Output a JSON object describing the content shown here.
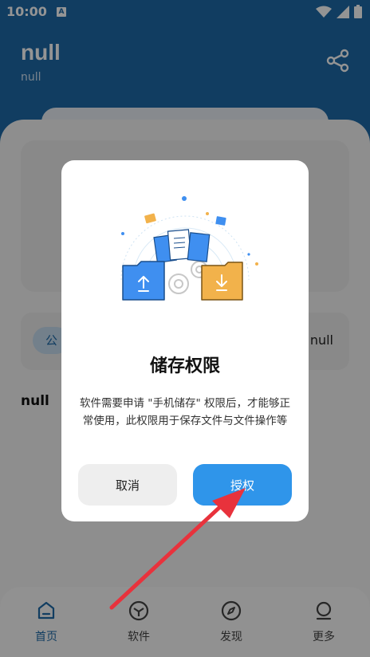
{
  "status_bar": {
    "time": "10:00",
    "a_badge": "A"
  },
  "header": {
    "title": "null",
    "subtitle": "null"
  },
  "main": {
    "notice": {
      "tag": "公",
      "text": "null"
    },
    "section_title": "null"
  },
  "bottom_nav": {
    "items": [
      {
        "label": "首页",
        "icon": "home-icon",
        "active": true
      },
      {
        "label": "软件",
        "icon": "cube-icon",
        "active": false
      },
      {
        "label": "发现",
        "icon": "compass-icon",
        "active": false
      },
      {
        "label": "更多",
        "icon": "profile-icon",
        "active": false
      }
    ]
  },
  "dialog": {
    "title": "储存权限",
    "message": "软件需要申请 \"手机储存\" 权限后，才能够正常使用，此权限用于保存文件与文件操作等",
    "cancel_label": "取消",
    "confirm_label": "授权"
  },
  "colors": {
    "primary": "#1e6aa8",
    "accent": "#2f95ea",
    "arrow": "#e8323c"
  }
}
